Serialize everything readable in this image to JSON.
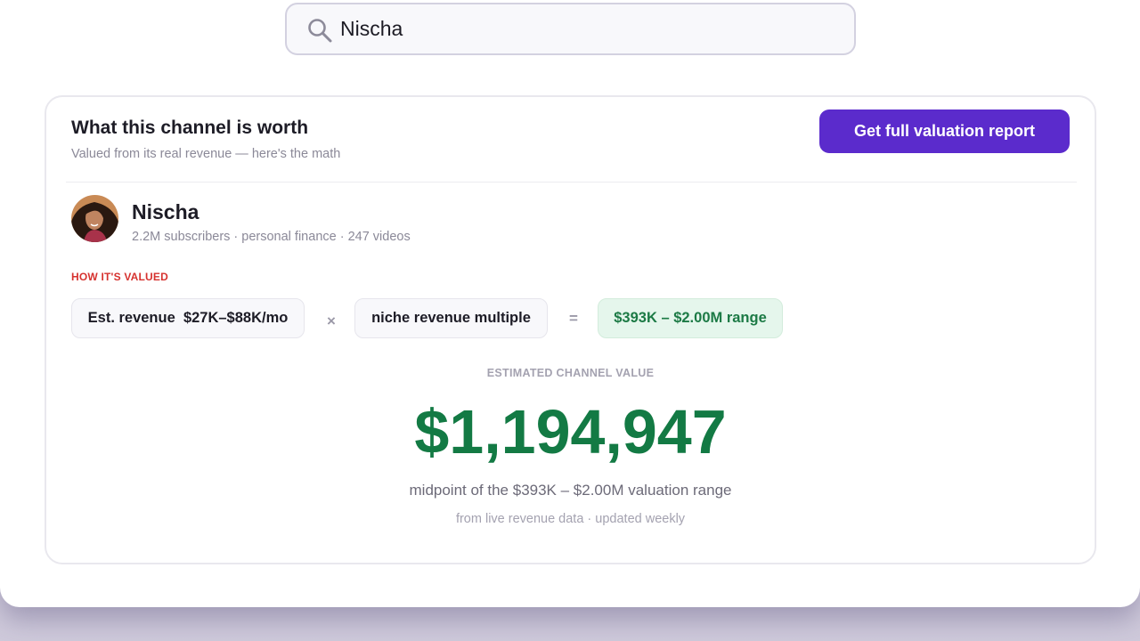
{
  "search": {
    "value": "Nischa"
  },
  "card": {
    "title": "What this channel is worth",
    "subtitle": "Valued from its real revenue — here's the math",
    "cta_label": "Get full valuation report"
  },
  "channel": {
    "name": "Nischa",
    "meta": "2.2M subscribers · personal finance · 247 videos"
  },
  "valuation": {
    "section_label": "HOW IT'S VALUED",
    "revenue_pill": "Est. revenue  $27K–$88K/mo",
    "times_symbol": "×",
    "multiple_pill": "niche revenue multiple",
    "equals_symbol": "=",
    "result_pill": "$393K – $2.00M range"
  },
  "estimate": {
    "label": "ESTIMATED CHANNEL VALUE",
    "value": "$1,194,947",
    "note": "midpoint of the $393K – $2.00M valuation range",
    "source": "from live revenue data · updated weekly"
  },
  "colors": {
    "accent": "#5b2bcc",
    "value_green": "#137a44",
    "label_red": "#d6322f"
  },
  "icons": {
    "search": "search-icon"
  }
}
